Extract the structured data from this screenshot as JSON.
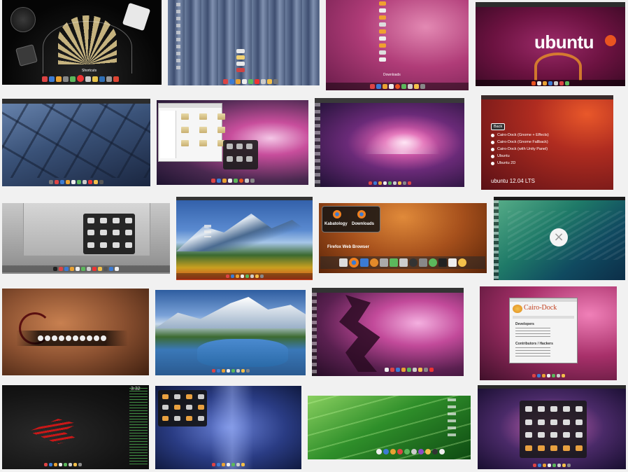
{
  "thumbnails": [
    {
      "id": "t1",
      "theme": "dark-analog-clock-arc-dock",
      "label": "Shortcuts",
      "bg": "#0b0b0b"
    },
    {
      "id": "t2",
      "theme": "blue-striped-vertical-dock",
      "bg": "#5d6f8e"
    },
    {
      "id": "t3",
      "theme": "pink-vertical-stack-dock",
      "label": "Downloads",
      "bg": "#b03c78"
    },
    {
      "id": "t4",
      "theme": "ubuntu-purple-arc-dock",
      "logo_text": "ubuntu",
      "bg": "#6b1240"
    },
    {
      "id": "t5",
      "theme": "blue-tiled-floor",
      "bg": "#24344f"
    },
    {
      "id": "t6",
      "theme": "file-manager-galaxy-grid",
      "bg": "#4a2950"
    },
    {
      "id": "t7",
      "theme": "galaxy-pink-left-dock",
      "bg": "#4b2a55"
    },
    {
      "id": "t8",
      "theme": "ubuntu-red-menu",
      "bg": "#7a1c18",
      "menu_items": [
        "Back",
        "Cairo-Dock (Gnome + Effects)",
        "Cairo-Dock (Gnome Fallback)",
        "Cairo-Dock (with Unity Panel)",
        "Ubuntu",
        "Ubuntu 2D"
      ],
      "logo_text": "ubuntu 12.04 LTS"
    },
    {
      "id": "t9",
      "theme": "grey-room-grid",
      "bg": "#9a9a9a"
    },
    {
      "id": "t10",
      "theme": "blue-mountains",
      "bg": "#3a6fb8"
    },
    {
      "id": "t11",
      "theme": "orange-firefox-dock",
      "bg": "#a6501c",
      "stack_labels": [
        "Kabatology",
        "Downloads"
      ],
      "tooltip": "Firefox Web Browser"
    },
    {
      "id": "t12",
      "theme": "green-wave-osx",
      "bg": "#1f7a68"
    },
    {
      "id": "t13",
      "theme": "copper-ubuntu-logo",
      "bg": "#8a5030"
    },
    {
      "id": "t14",
      "theme": "alpine-lake",
      "bg": "#2e5da0"
    },
    {
      "id": "t15",
      "theme": "pink-purple-wave",
      "bg": "#5a2050"
    },
    {
      "id": "t16",
      "theme": "cairo-dock-dialog",
      "bg": "#6a2048",
      "dialog_title": "Cairo-Dock",
      "dialog_sections": [
        "Developers",
        "Contributors / Hackers"
      ]
    },
    {
      "id": "t17",
      "theme": "dark-red-ubuntu-conky",
      "bg": "#141414",
      "clock": "3:32"
    },
    {
      "id": "t18",
      "theme": "blue-vertical-light-grid",
      "bg": "#2a3c84"
    },
    {
      "id": "t19",
      "theme": "green-grass-dock",
      "bg": "#2f8f2a"
    },
    {
      "id": "t20",
      "theme": "galaxy-app-grid",
      "bg": "#4a2a68"
    }
  ],
  "colors": {
    "page_bg": "#f1f1f1",
    "highlight": "#4a90e2"
  }
}
